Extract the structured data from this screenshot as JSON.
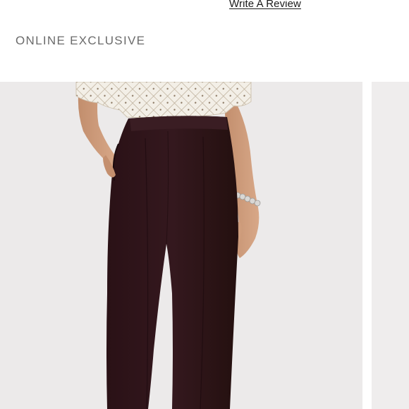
{
  "product": {
    "review_link": "Write A Review",
    "badge": "ONLINE EXCLUSIVE"
  },
  "gallery": {
    "main_image_alt": "Model wearing plum pull-on ankle pants with patterned blouse and pearl bracelet",
    "next_image_alt": "Next product image"
  },
  "colors": {
    "pants": "#2e1419",
    "background": "#eceaea",
    "text_muted": "#6b6b6b"
  }
}
